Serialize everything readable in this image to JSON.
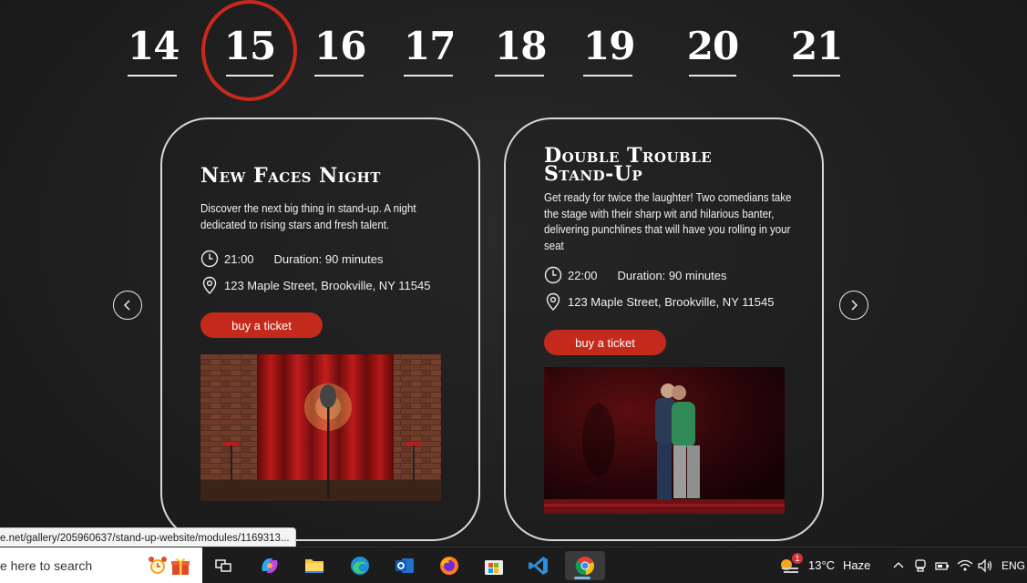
{
  "dates": {
    "items": [
      "14",
      "15",
      "16",
      "17",
      "18",
      "19",
      "20",
      "21"
    ],
    "selected": "15",
    "accent_color": "#c8291c"
  },
  "cards": [
    {
      "title": "New Faces Night",
      "description": "Discover the next big thing in stand-up. A night dedicated to rising stars and fresh talent.",
      "time": "21:00",
      "duration": "Duration: 90 minutes",
      "address": "123 Maple Street, Brookville, NY 11545",
      "button_label": "buy a ticket",
      "image": "stage-with-microphone-red-curtain"
    },
    {
      "title_line1": "Double Trouble",
      "title_line2": "Stand-Up",
      "description": "Get ready for twice the laughter! Two comedians take the stage with their sharp wit and hilarious banter, delivering punchlines that will have you rolling in your seat",
      "time": "22:00",
      "duration": "Duration: 90 minutes",
      "address": "123 Maple Street, Brookville, NY 11545",
      "button_label": "buy a ticket",
      "image": "two-comedians-hugging-on-stage"
    }
  ],
  "nav": {
    "prev_icon": "chevron-left-icon",
    "next_icon": "chevron-right-icon"
  },
  "status_url": "e.net/gallery/205960637/stand-up-website/modules/1169313...",
  "taskbar": {
    "search_placeholder": "e here to search",
    "weather_badge": "1",
    "weather_temp": "13°C",
    "weather_desc": "Haze",
    "language": "ENG"
  },
  "colors": {
    "button": "#c42a1b",
    "background": "#1f1f1f"
  }
}
